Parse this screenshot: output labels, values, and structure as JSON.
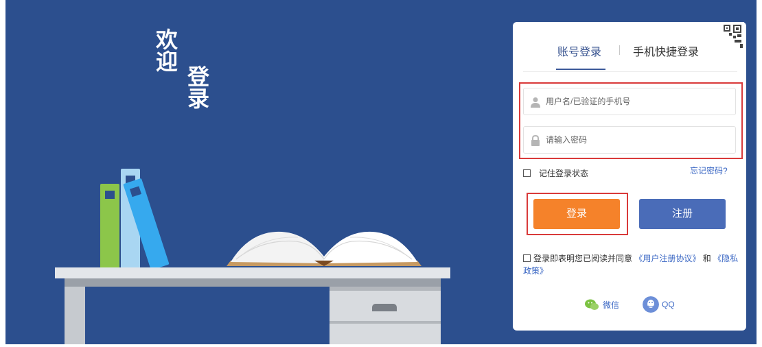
{
  "welcome": {
    "line1": "欢迎",
    "line2": "登录"
  },
  "login": {
    "tabs": {
      "account": "账号登录",
      "phone": "手机快捷登录"
    },
    "username": {
      "placeholder": "用户名/已验证的手机号",
      "value": ""
    },
    "password": {
      "placeholder": "请输入密码",
      "value": ""
    },
    "remember_label": "记住登录状态",
    "remember_checked": false,
    "forgot_label": "忘记密码?",
    "login_button": "登录",
    "register_button": "注册",
    "agreement": {
      "checked": false,
      "prefix": "登录即表明您已阅读并同意",
      "user_agreement": "《用户注册协议》",
      "and": "和",
      "privacy_policy": "《隐私政策》"
    },
    "social": {
      "wechat": "微信",
      "qq": "QQ"
    }
  },
  "colors": {
    "background": "#2c4f8e",
    "accent_orange": "#f5822a",
    "accent_blue": "#4a6cb8",
    "link_blue": "#3a67c4",
    "highlight_red": "#d93a3a"
  },
  "icons": [
    "user-icon",
    "lock-icon",
    "qr-code-icon",
    "wechat-icon",
    "qq-icon"
  ]
}
